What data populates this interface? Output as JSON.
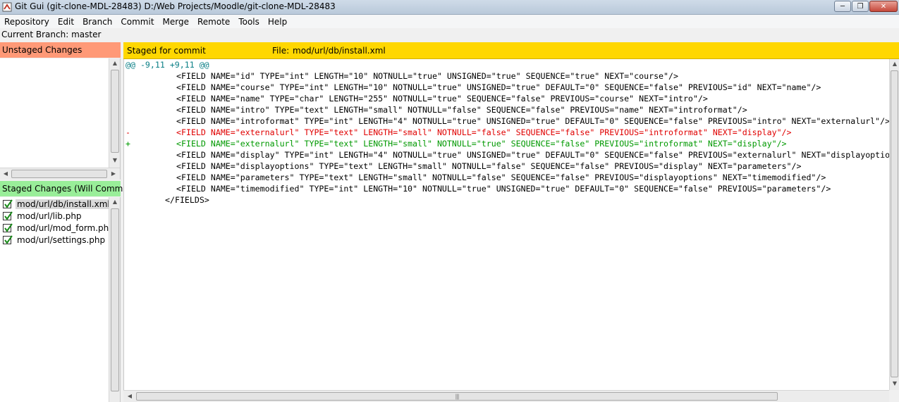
{
  "window": {
    "title": "Git Gui (git-clone-MDL-28483) D:/Web Projects/Moodle/git-clone-MDL-28483"
  },
  "menu": [
    "Repository",
    "Edit",
    "Branch",
    "Commit",
    "Merge",
    "Remote",
    "Tools",
    "Help"
  ],
  "branch": {
    "text": "Current Branch: master"
  },
  "unstaged": {
    "header": "Unstaged Changes",
    "files": []
  },
  "staged": {
    "header": "Staged Changes (Will Commit)",
    "files": [
      "mod/url/db/install.xml",
      "mod/url/lib.php",
      "mod/url/mod_form.php",
      "mod/url/settings.php"
    ],
    "selected_index": 0
  },
  "diff": {
    "status": "Staged for commit",
    "file_label": "File:",
    "file_path": "mod/url/db/install.xml",
    "lines": [
      {
        "type": "hunk",
        "marker": "",
        "text": "@@ -9,11 +9,11 @@"
      },
      {
        "type": "context",
        "marker": "",
        "text": "<FIELD NAME=\"id\" TYPE=\"int\" LENGTH=\"10\" NOTNULL=\"true\" UNSIGNED=\"true\" SEQUENCE=\"true\" NEXT=\"course\"/>"
      },
      {
        "type": "context",
        "marker": "",
        "text": "<FIELD NAME=\"course\" TYPE=\"int\" LENGTH=\"10\" NOTNULL=\"true\" UNSIGNED=\"true\" DEFAULT=\"0\" SEQUENCE=\"false\" PREVIOUS=\"id\" NEXT=\"name\"/>"
      },
      {
        "type": "context",
        "marker": "",
        "text": "<FIELD NAME=\"name\" TYPE=\"char\" LENGTH=\"255\" NOTNULL=\"true\" SEQUENCE=\"false\" PREVIOUS=\"course\" NEXT=\"intro\"/>"
      },
      {
        "type": "context",
        "marker": "",
        "text": "<FIELD NAME=\"intro\" TYPE=\"text\" LENGTH=\"small\" NOTNULL=\"false\" SEQUENCE=\"false\" PREVIOUS=\"name\" NEXT=\"introformat\"/>"
      },
      {
        "type": "context",
        "marker": "",
        "text": "<FIELD NAME=\"introformat\" TYPE=\"int\" LENGTH=\"4\" NOTNULL=\"true\" UNSIGNED=\"true\" DEFAULT=\"0\" SEQUENCE=\"false\" PREVIOUS=\"intro\" NEXT=\"externalurl\"/>"
      },
      {
        "type": "removed",
        "marker": "-",
        "text": "<FIELD NAME=\"externalurl\" TYPE=\"text\" LENGTH=\"small\" NOTNULL=\"false\" SEQUENCE=\"false\" PREVIOUS=\"introformat\" NEXT=\"display\"/>"
      },
      {
        "type": "added",
        "marker": "+",
        "text": "<FIELD NAME=\"externalurl\" TYPE=\"text\" LENGTH=\"small\" NOTNULL=\"true\" SEQUENCE=\"false\" PREVIOUS=\"introformat\" NEXT=\"display\"/>"
      },
      {
        "type": "context",
        "marker": "",
        "text": "<FIELD NAME=\"display\" TYPE=\"int\" LENGTH=\"4\" NOTNULL=\"true\" UNSIGNED=\"true\" DEFAULT=\"0\" SEQUENCE=\"false\" PREVIOUS=\"externalurl\" NEXT=\"displayoptions\"/>"
      },
      {
        "type": "context",
        "marker": "",
        "text": "<FIELD NAME=\"displayoptions\" TYPE=\"text\" LENGTH=\"small\" NOTNULL=\"false\" SEQUENCE=\"false\" PREVIOUS=\"display\" NEXT=\"parameters\"/>"
      },
      {
        "type": "context",
        "marker": "",
        "text": "<FIELD NAME=\"parameters\" TYPE=\"text\" LENGTH=\"small\" NOTNULL=\"false\" SEQUENCE=\"false\" PREVIOUS=\"displayoptions\" NEXT=\"timemodified\"/>"
      },
      {
        "type": "context",
        "marker": "",
        "text": "<FIELD NAME=\"timemodified\" TYPE=\"int\" LENGTH=\"10\" NOTNULL=\"true\" UNSIGNED=\"true\" DEFAULT=\"0\" SEQUENCE=\"false\" PREVIOUS=\"parameters\"/>"
      },
      {
        "type": "closing",
        "marker": "",
        "text": "</FIELDS>"
      }
    ]
  }
}
